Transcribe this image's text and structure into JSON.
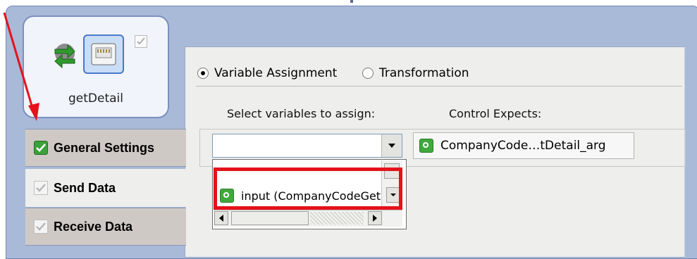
{
  "colors": {
    "window_frame": "#a9b9d8",
    "panel_bg": "#eeeeec",
    "tab_selected_bg": "#cfc9c6",
    "highlight": "#e4121b",
    "arrow": "#e4121b",
    "check_green": "#3ba13a"
  },
  "action": {
    "label": "getDetail",
    "icons": [
      "exchange-arrows-icon",
      "network-port-icon",
      "status-checkbox-icon"
    ]
  },
  "tabs": [
    {
      "label": "General Settings",
      "checked": true,
      "selected": true
    },
    {
      "label": "Send Data",
      "checked": true,
      "selected": false
    },
    {
      "label": "Receive Data",
      "checked": true,
      "selected": false
    }
  ],
  "mode": {
    "options": [
      {
        "label": "Variable Assignment",
        "selected": true
      },
      {
        "label": "Transformation",
        "selected": false
      }
    ]
  },
  "assign": {
    "select_header": "Select variables to assign:",
    "expects_header": "Control Expects:",
    "combo_value": "",
    "expects_value": "CompanyCode…tDetail_arg",
    "dropdown_item": "input (CompanyCodeGetDetail_arg)"
  }
}
